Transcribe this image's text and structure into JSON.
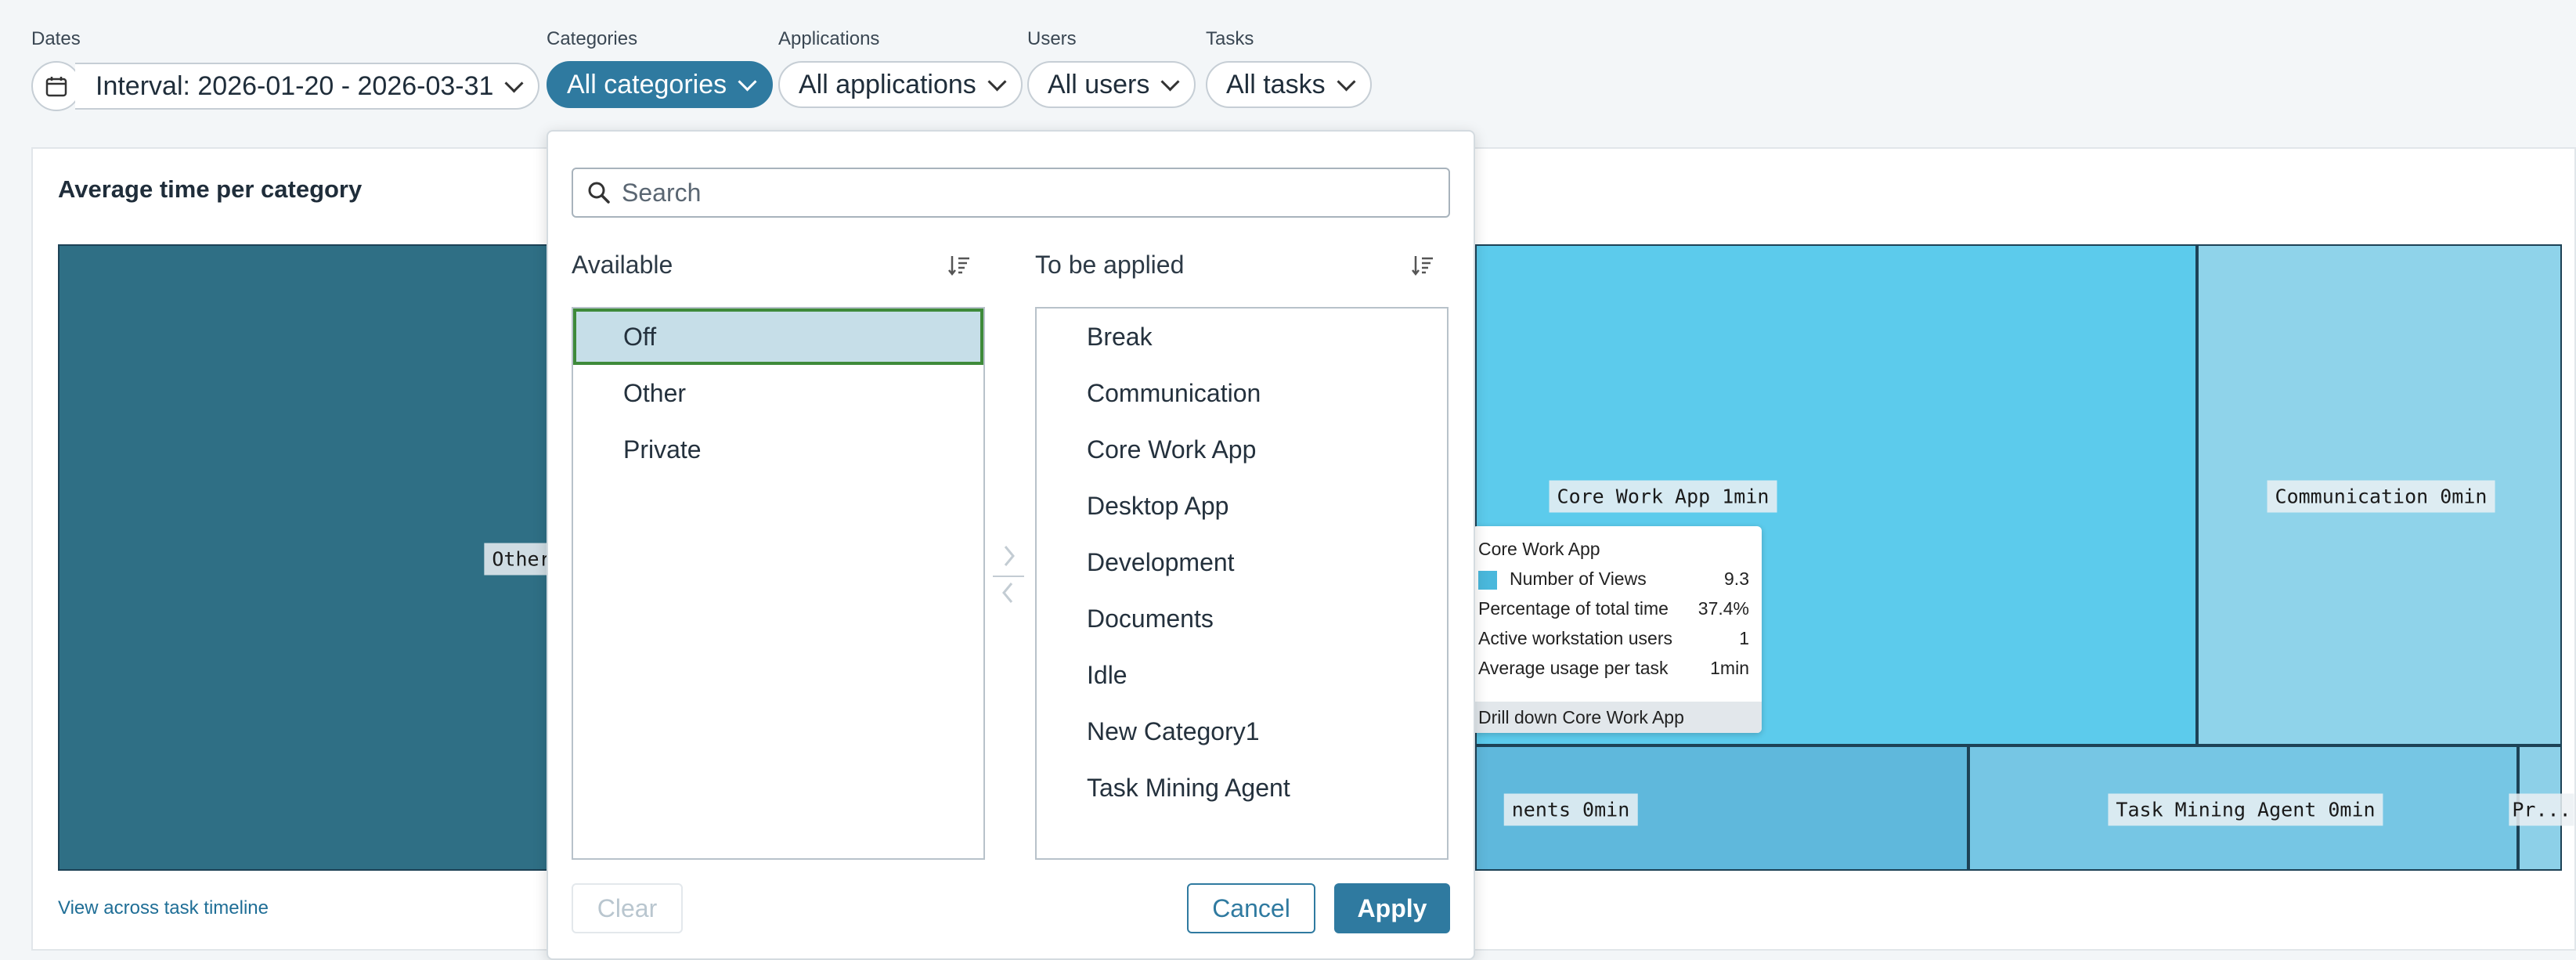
{
  "filters": {
    "dates": {
      "label": "Dates",
      "value": "Interval: 2026-01-20 - 2026-03-31"
    },
    "categories": {
      "label": "Categories",
      "value": "All categories"
    },
    "applications": {
      "label": "Applications",
      "value": "All applications"
    },
    "users": {
      "label": "Users",
      "value": "All users"
    },
    "tasks": {
      "label": "Tasks",
      "value": "All tasks"
    }
  },
  "card": {
    "title": "Average time per category",
    "link": "View across task timeline"
  },
  "treemap": {
    "tiles": [
      {
        "label": "Other",
        "color": "#2f6f85"
      },
      {
        "label": "Core Work App 1min",
        "color": "#5ccbec"
      },
      {
        "label": "Communication 0min",
        "color": "#8fd3ea"
      },
      {
        "label": "nents 0min",
        "color": "#5fb8dc"
      },
      {
        "label": "Task Mining Agent 0min",
        "color": "#76c6e4"
      },
      {
        "label": "Pr...",
        "color": "#8dd0e8"
      }
    ]
  },
  "tooltip": {
    "title": "Core Work App",
    "swatch_color": "#4ab8dc",
    "rows": [
      {
        "label": "Number of Views",
        "value": "9.3"
      },
      {
        "label": "Percentage of total time",
        "value": "37.4%"
      },
      {
        "label": "Active workstation users",
        "value": "1"
      },
      {
        "label": "Average usage per task",
        "value": "1min"
      }
    ],
    "drill": "Drill down Core Work App"
  },
  "dropdown": {
    "search_placeholder": "Search",
    "available_title": "Available",
    "applied_title": "To be applied",
    "available": [
      "Off",
      "Other",
      "Private"
    ],
    "applied": [
      "Break",
      "Communication",
      "Core Work App",
      "Desktop App",
      "Development",
      "Documents",
      "Idle",
      "New Category1",
      "Task Mining Agent"
    ],
    "clear": "Clear",
    "cancel": "Cancel",
    "apply": "Apply"
  }
}
